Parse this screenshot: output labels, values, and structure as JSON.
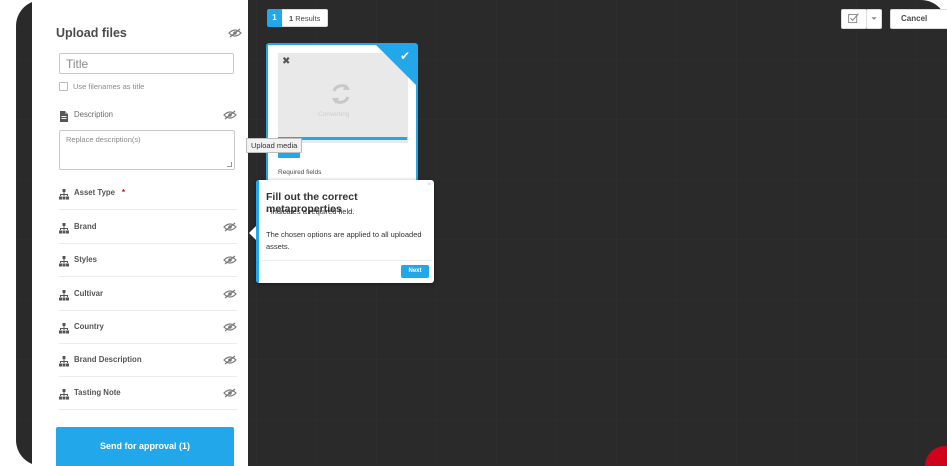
{
  "sidebar": {
    "title": "Upload files",
    "title_input": {
      "value": "Title",
      "placeholder": "Title"
    },
    "use_filenames_label": "Use filenames as title",
    "description": {
      "label": "Description",
      "placeholder": "Replace description(s)"
    },
    "fields": [
      {
        "label": "Asset Type",
        "required": "*",
        "icon": "hierarchy-icon"
      },
      {
        "label": "Brand",
        "icon": "hierarchy-icon"
      },
      {
        "label": "Styles",
        "icon": "hierarchy-icon"
      },
      {
        "label": "Cultivar",
        "icon": "hierarchy-icon"
      },
      {
        "label": "Country",
        "icon": "hierarchy-icon"
      },
      {
        "label": "Brand Description",
        "icon": "hierarchy-icon"
      },
      {
        "label": "Tasting Note",
        "icon": "hierarchy-icon"
      }
    ],
    "send_button": "Send for approval (1)"
  },
  "topbar": {
    "page_number": "1",
    "results_count": "1",
    "results_label": "Results",
    "cancel_label": "Cancel"
  },
  "asset_card": {
    "thumbnail_text": "Converting",
    "required_fields": "Required fields",
    "progress": 0.99
  },
  "tooltip": {
    "upload_media": "Upload media"
  },
  "guide": {
    "title": "Fill out the correct metaproperties",
    "required_star": "*",
    "required_note": " indicates a required field.",
    "body": "The chosen options are applied to all uploaded assets.",
    "next_label": "Next",
    "close_label": "×"
  },
  "colors": {
    "accent": "#22a7ea",
    "required": "#d0021b",
    "backdrop": "#2a2a2a"
  }
}
